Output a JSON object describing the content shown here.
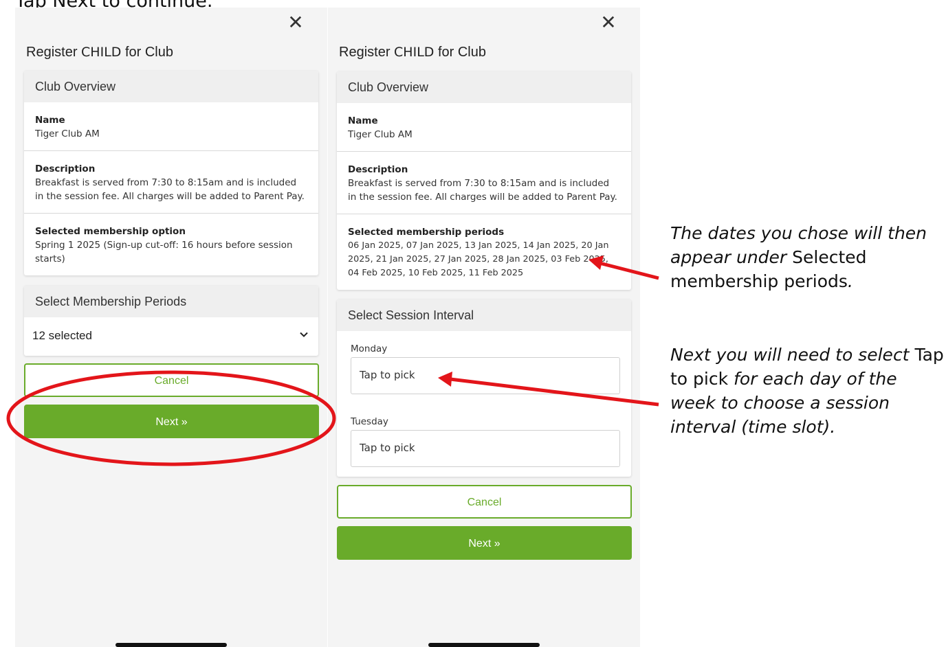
{
  "instruction": {
    "prefix": "Tap ",
    "bold": "Next",
    "suffix": " to continue."
  },
  "left": {
    "title_prefix": "Register ",
    "title_child": "CHILD",
    "title_suffix": " for Club",
    "overview": {
      "heading": "Club Overview",
      "name_label": "Name",
      "name_value": "Tiger Club AM",
      "desc_label": "Description",
      "desc_value": "Breakfast is served from 7:30 to 8:15am and is included in the session fee. All charges will be added to Parent Pay.",
      "option_label": "Selected membership option",
      "option_value": "Spring 1 2025 (Sign-up cut-off: 16 hours before session starts)"
    },
    "periods": {
      "heading": "Select Membership Periods",
      "selected": "12 selected"
    },
    "cancel_label": "Cancel",
    "next_label": "Next »"
  },
  "right": {
    "title_prefix": "Register ",
    "title_child": "CHILD",
    "title_suffix": " for Club",
    "overview": {
      "heading": "Club Overview",
      "name_label": "Name",
      "name_value": "Tiger Club AM",
      "desc_label": "Description",
      "desc_value": "Breakfast is served from 7:30 to 8:15am and is included in the session fee. All charges will be added to Parent Pay.",
      "periods_label": "Selected membership periods",
      "periods_value": "06 Jan 2025, 07 Jan 2025, 13 Jan 2025, 14 Jan 2025, 20 Jan 2025, 21 Jan 2025, 27 Jan 2025, 28 Jan 2025, 03 Feb 2025, 04 Feb 2025, 10 Feb 2025, 11 Feb 2025"
    },
    "interval": {
      "heading": "Select Session Interval",
      "days": [
        {
          "label": "Monday",
          "value": "Tap to pick"
        },
        {
          "label": "Tuesday",
          "value": "Tap to pick"
        }
      ]
    },
    "cancel_label": "Cancel",
    "next_label": "Next »"
  },
  "annotations": {
    "first": {
      "text": "The dates you chose will then appear under ",
      "bold": "Selected membership periods",
      "end": "."
    },
    "second": {
      "text_start": "Next you will need to select ",
      "bold": "Tap to pick",
      "text_end": " for each day of the week to choose a session interval (time slot)."
    }
  },
  "colors": {
    "accent_green": "#69ab2a",
    "annotation_red": "#e3151a"
  }
}
